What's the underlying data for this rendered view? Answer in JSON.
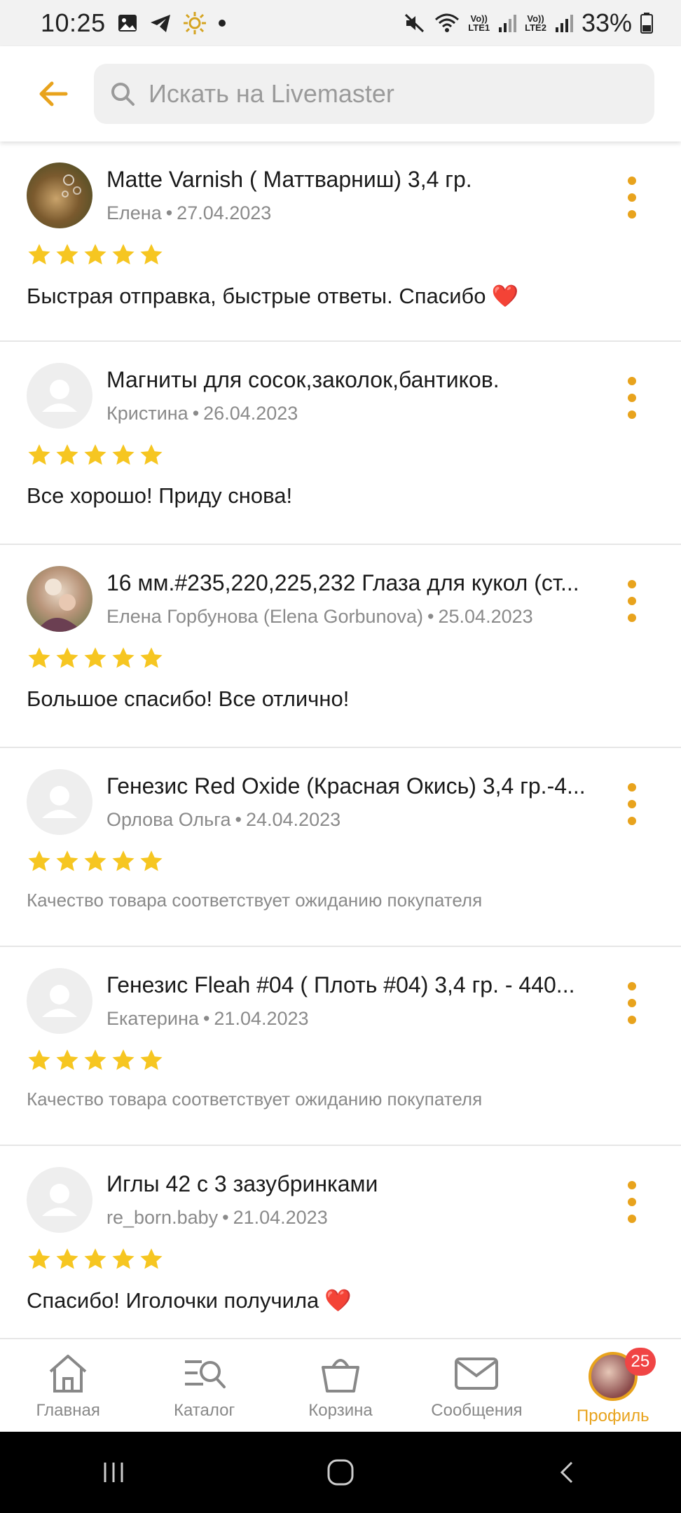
{
  "status_bar": {
    "time": "10:25",
    "battery": "33%",
    "lte1": "LTE1",
    "lte2": "LTE2",
    "volte": "Vo))"
  },
  "header": {
    "search_placeholder": "Искать на Livemaster"
  },
  "colors": {
    "accent": "#e8a31d",
    "star": "#f6c621",
    "badge": "#f04545"
  },
  "reviews": [
    {
      "product": "Matte Varnish ( Маттварниш) 3,4 гр.",
      "author": "Елена",
      "date": "27.04.2023",
      "rating": 5,
      "text": "Быстрая отправка, быстрые ответы. Спасибо",
      "emoji": "❤️",
      "avatar": "photo-1"
    },
    {
      "product": "Магниты для сосок,заколок,бантиков.",
      "author": "Кристина",
      "date": "26.04.2023",
      "rating": 5,
      "text": "Все хорошо! Приду снова!",
      "avatar": "placeholder"
    },
    {
      "product": "16 мм.#235,220,225,232 Глаза для кукол (ст...",
      "author": "Елена Горбунова (Elena Gorbunova)",
      "date": "25.04.2023",
      "rating": 5,
      "text": "Большое спасибо! Все отлично!",
      "avatar": "photo-2"
    },
    {
      "product": "Генезис Red Oxide (Красная Окись) 3,4 гр.-4...",
      "author": "Орлова Ольга",
      "date": "24.04.2023",
      "rating": 5,
      "text": "Качество товара соответствует ожиданию покупателя",
      "avatar": "placeholder"
    },
    {
      "product": "Генезис Fleah #04 ( Плоть #04) 3,4 гр. - 440...",
      "author": "Екатерина",
      "date": "21.04.2023",
      "rating": 5,
      "text": "Качество товара соответствует ожиданию покупателя",
      "avatar": "placeholder"
    },
    {
      "product": "Иглы 42 с 3 зазубринками",
      "author": "re_born.baby",
      "date": "21.04.2023",
      "rating": 5,
      "text": "Спасибо! Иголочки получила",
      "emoji": "❤️",
      "avatar": "placeholder"
    }
  ],
  "bottom_nav": {
    "home": "Главная",
    "catalog": "Каталог",
    "cart": "Корзина",
    "messages": "Сообщения",
    "profile": "Профиль",
    "profile_badge": "25"
  }
}
